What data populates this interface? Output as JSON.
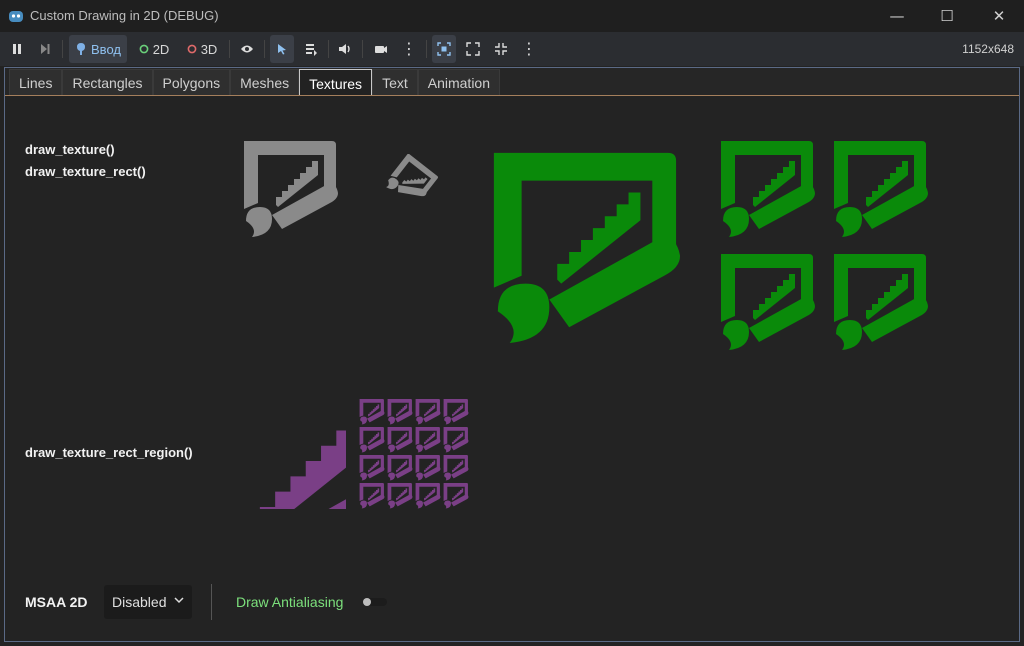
{
  "window": {
    "title": "Custom Drawing in 2D (DEBUG)",
    "resolution": "1152x648"
  },
  "toolbar": {
    "input_label": "Ввод",
    "mode_2d": "2D",
    "mode_3d": "3D"
  },
  "tabs": [
    "Lines",
    "Rectangles",
    "Polygons",
    "Meshes",
    "Textures",
    "Text",
    "Animation"
  ],
  "active_tab": "Textures",
  "labels": {
    "draw_texture": "draw_texture()",
    "draw_texture_rect": "draw_texture_rect()",
    "draw_texture_rect_region": "draw_texture_rect_region()"
  },
  "controls": {
    "msaa_label": "MSAA 2D",
    "msaa_value": "Disabled",
    "antialias_label": "Draw Antialiasing",
    "antialias_on": false
  },
  "colors": {
    "gray": "#8a8a8a",
    "green": "#0a8a0a",
    "purple": "#7a3f86",
    "accent_green": "#7ce07c"
  },
  "icons": {
    "app": "godot-icon",
    "pause": "pause-icon",
    "step": "step-icon",
    "input": "input-icon",
    "visibility": "eye-icon",
    "select": "select-arrow-icon",
    "list": "list-icon",
    "audio": "speaker-icon",
    "camera": "camera-icon",
    "more": "more-icon",
    "embed": "embed-icon",
    "fullscreen": "fullscreen-icon",
    "shrink": "shrink-icon"
  }
}
